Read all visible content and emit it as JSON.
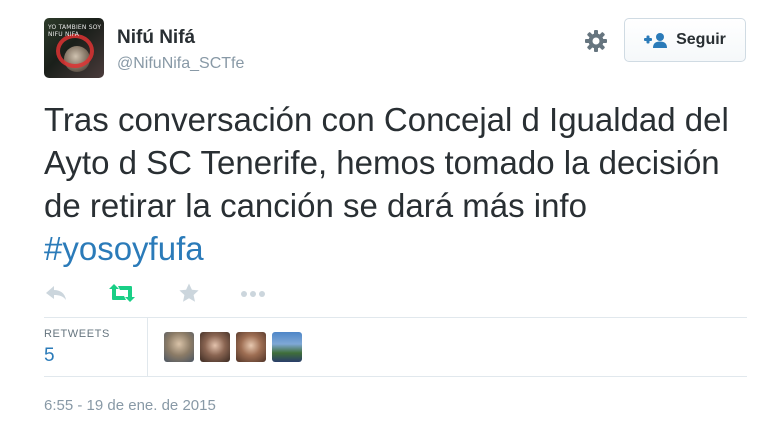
{
  "user": {
    "name": "Nifú Nifá",
    "handle": "@NifuNifa_SCTfe",
    "avatar_icon": "profile-avatar",
    "avatar_text": "YO TAMBIEN SOY NIFU NIFA"
  },
  "header": {
    "settings_icon": "gear-icon",
    "follow_button_label": "Seguir",
    "follow_icon": "add-user-icon"
  },
  "tweet": {
    "text_before_hashtag": "Tras conversación con Concejal d Igualdad del Ayto d SC Tenerife, hemos tomado la decisión de retirar la canción se dará más info ",
    "hashtag": "#yosoyfufa"
  },
  "actions": [
    {
      "name": "reply",
      "icon": "reply-icon"
    },
    {
      "name": "retweet",
      "icon": "retweet-icon",
      "active_color": "#19cf86"
    },
    {
      "name": "favorite",
      "icon": "star-icon"
    },
    {
      "name": "more",
      "icon": "more-icon"
    }
  ],
  "stats": {
    "retweets_label": "RETWEETS",
    "retweets_count": "5"
  },
  "timestamp": "6:55 - 19 de ene. de 2015",
  "colors": {
    "link": "#2b7bb9",
    "retweet_green": "#19cf86",
    "muted": "#8899a6",
    "icon_gray": "#ccd6dd"
  }
}
